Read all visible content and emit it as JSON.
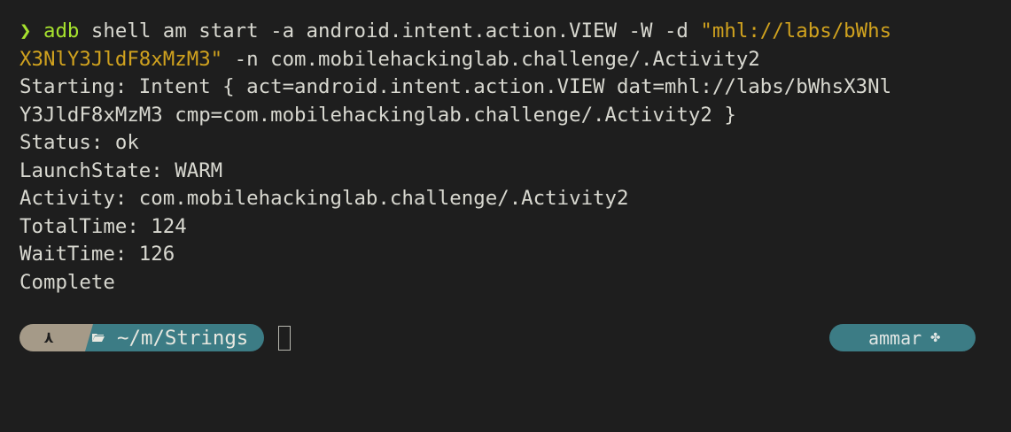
{
  "terminal": {
    "command": {
      "prompt_symbol": "❯",
      "program": "adb",
      "line1_args": " shell am start -a android.intent.action.VIEW -W -d ",
      "line1_string": "\"mhl://labs/bWhs",
      "line2_string": "X3NlY3JldF8xMzM3\"",
      "line2_rest": " -n com.mobilehackinglab.challenge/.Activity2"
    },
    "output": [
      "Starting: Intent { act=android.intent.action.VIEW dat=mhl://labs/bWhsX3Nl",
      "Y3JldF8xMzM3 cmp=com.mobilehackinglab.challenge/.Activity2 }",
      "Status: ok",
      "LaunchState: WARM",
      "Activity: com.mobilehackinglab.challenge/.Activity2",
      "TotalTime: 124",
      "WaitTime: 126",
      "Complete"
    ]
  },
  "prompt": {
    "os_icon": "⋏",
    "path_icon": "folder-open-icon",
    "path": "~/m/Strings",
    "user": "ammar",
    "user_icon": "python-icon"
  },
  "colors": {
    "background": "#1e1e1e",
    "text": "#d8d8d0",
    "command_green": "#a6e22e",
    "string_yellow": "#d0a21e",
    "os_segment": "#a59a88",
    "path_segment": "#3c7c85"
  }
}
